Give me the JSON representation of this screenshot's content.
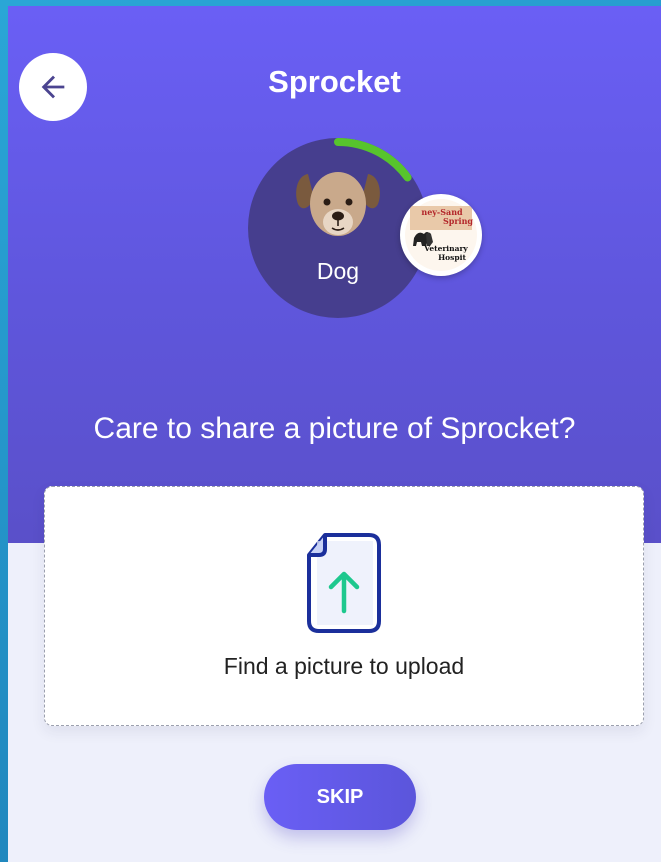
{
  "header": {
    "title": "Sprocket",
    "back_icon": "arrow-left-icon"
  },
  "pet": {
    "type_label": "Dog",
    "icon": "dog-icon",
    "profile_progress": 0.15,
    "progress_color": "#57c42d"
  },
  "clinic_badge": {
    "logo_text_line1": "ney-Sand",
    "logo_text_line2": "Spring",
    "logo_text_line3": "Veterinary",
    "logo_text_line4": "Hospit"
  },
  "main": {
    "prompt": "Care to share a picture of Sprocket?",
    "upload_label": "Find a picture to upload",
    "upload_icon": "file-upload-icon",
    "skip_label": "SKIP"
  },
  "colors": {
    "hero_gradient_top": "#6a5ff5",
    "hero_gradient_bottom": "#5a50c9",
    "accent": "#5b55db",
    "upload_icon_outline": "#1b2f9b",
    "upload_arrow": "#1ec88e"
  }
}
